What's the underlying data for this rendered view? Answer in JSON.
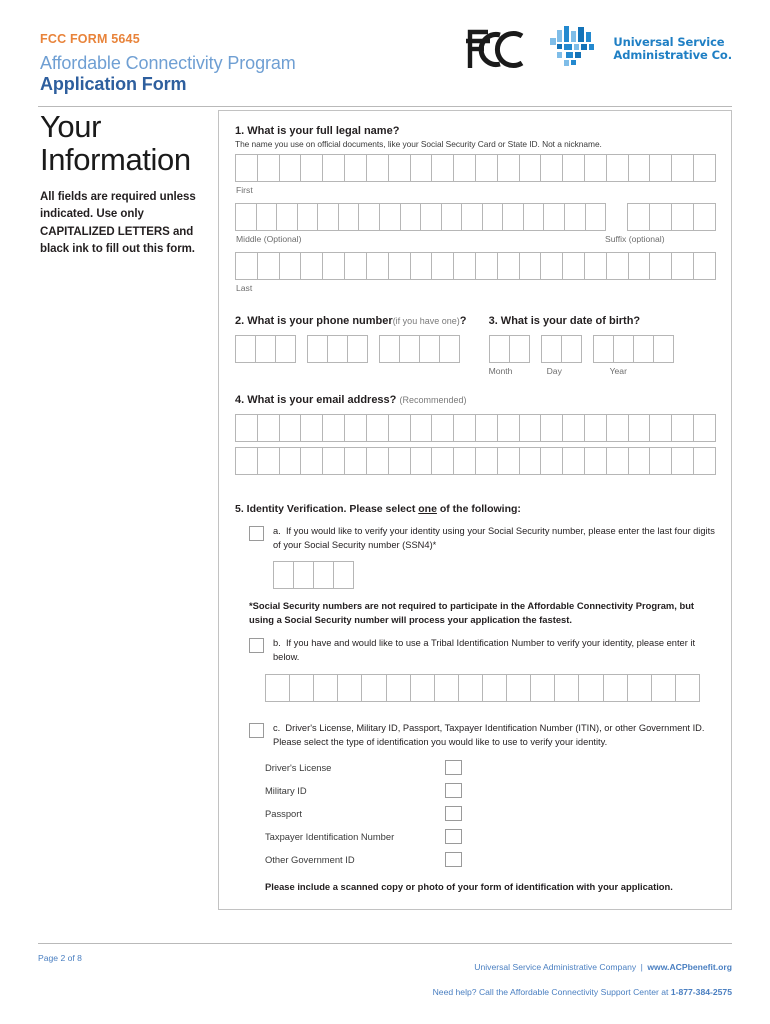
{
  "header": {
    "form_number": "FCC FORM 5645",
    "title_line1": "Affordable Connectivity Program",
    "title_line2": "Application Form",
    "fcc_logo_name": "FCC",
    "usac_line1": "Universal Service",
    "usac_line2": "Administrative Co.",
    "colors": {
      "orange": "#e8833a",
      "light_blue": "#6f9fd3",
      "dark_blue": "#2e5f9e",
      "usac_blue": "#1f7fc4"
    }
  },
  "sidebar": {
    "heading_line1": "Your",
    "heading_line2": "Information",
    "note": "All fields are required unless indicated. Use only CAPITALIZED LETTERS and black ink to fill out this form."
  },
  "questions": {
    "q1": {
      "title": "1. What is your full legal name?",
      "subtitle": "The name you use on official documents, like your Social Security Card or State ID. Not a nickname.",
      "first_label": "First",
      "first_boxes": 22,
      "middle_label": "Middle (Optional)",
      "middle_boxes": 18,
      "suffix_label": "Suffix (optional)",
      "suffix_boxes": 4,
      "last_label": "Last",
      "last_boxes": 22
    },
    "q2": {
      "title_main": "2. What is your phone number",
      "title_light": "(if you have one)",
      "title_end": "?",
      "segments": [
        3,
        3,
        4
      ]
    },
    "q3": {
      "title": "3. What is your date of birth?",
      "month_label": "Month",
      "month_boxes": 2,
      "day_label": "Day",
      "day_boxes": 2,
      "year_label": "Year",
      "year_boxes": 4
    },
    "q4": {
      "title_main": "4. What is your email address?",
      "title_light": "(Recommended)",
      "row_boxes": 22,
      "rows": 2
    },
    "q5": {
      "title_pre": "5. Identity Verification. Please select ",
      "title_underline": "one",
      "title_post": " of the following:",
      "option_a": {
        "letter": "a.",
        "text": "If you would like to verify your identity using your Social Security number, please enter the last four digits of your Social Security number (SSN4)*",
        "boxes": 4
      },
      "ssn_note": "*Social Security numbers are not required to participate in the Affordable Connectivity Program, but using a Social Security number will process your application the fastest.",
      "option_b": {
        "letter": "b.",
        "text": "If you have and would like to use a Tribal Identification Number to verify your identity, please enter it below.",
        "boxes": 18
      },
      "option_c": {
        "letter": "c.",
        "text": "Driver's License, Military ID, Passport, Taxpayer Identification Number (ITIN), or other Government ID. Please select the type of identification you would like to use to verify your identity."
      },
      "id_types": [
        "Driver's License",
        "Military ID",
        "Passport",
        "Taxpayer Identification Number",
        "Other Government ID"
      ],
      "final_note": "Please include a scanned copy or photo of your form of identification with your application."
    }
  },
  "footer": {
    "page": "Page 2 of 8",
    "org": "Universal Service Administrative Company",
    "separator": "|",
    "website": "www.ACPbenefit.org",
    "help_pre": "Need help? Call the Affordable Connectivity Support Center at ",
    "help_phone": "1-877-384-2575"
  }
}
